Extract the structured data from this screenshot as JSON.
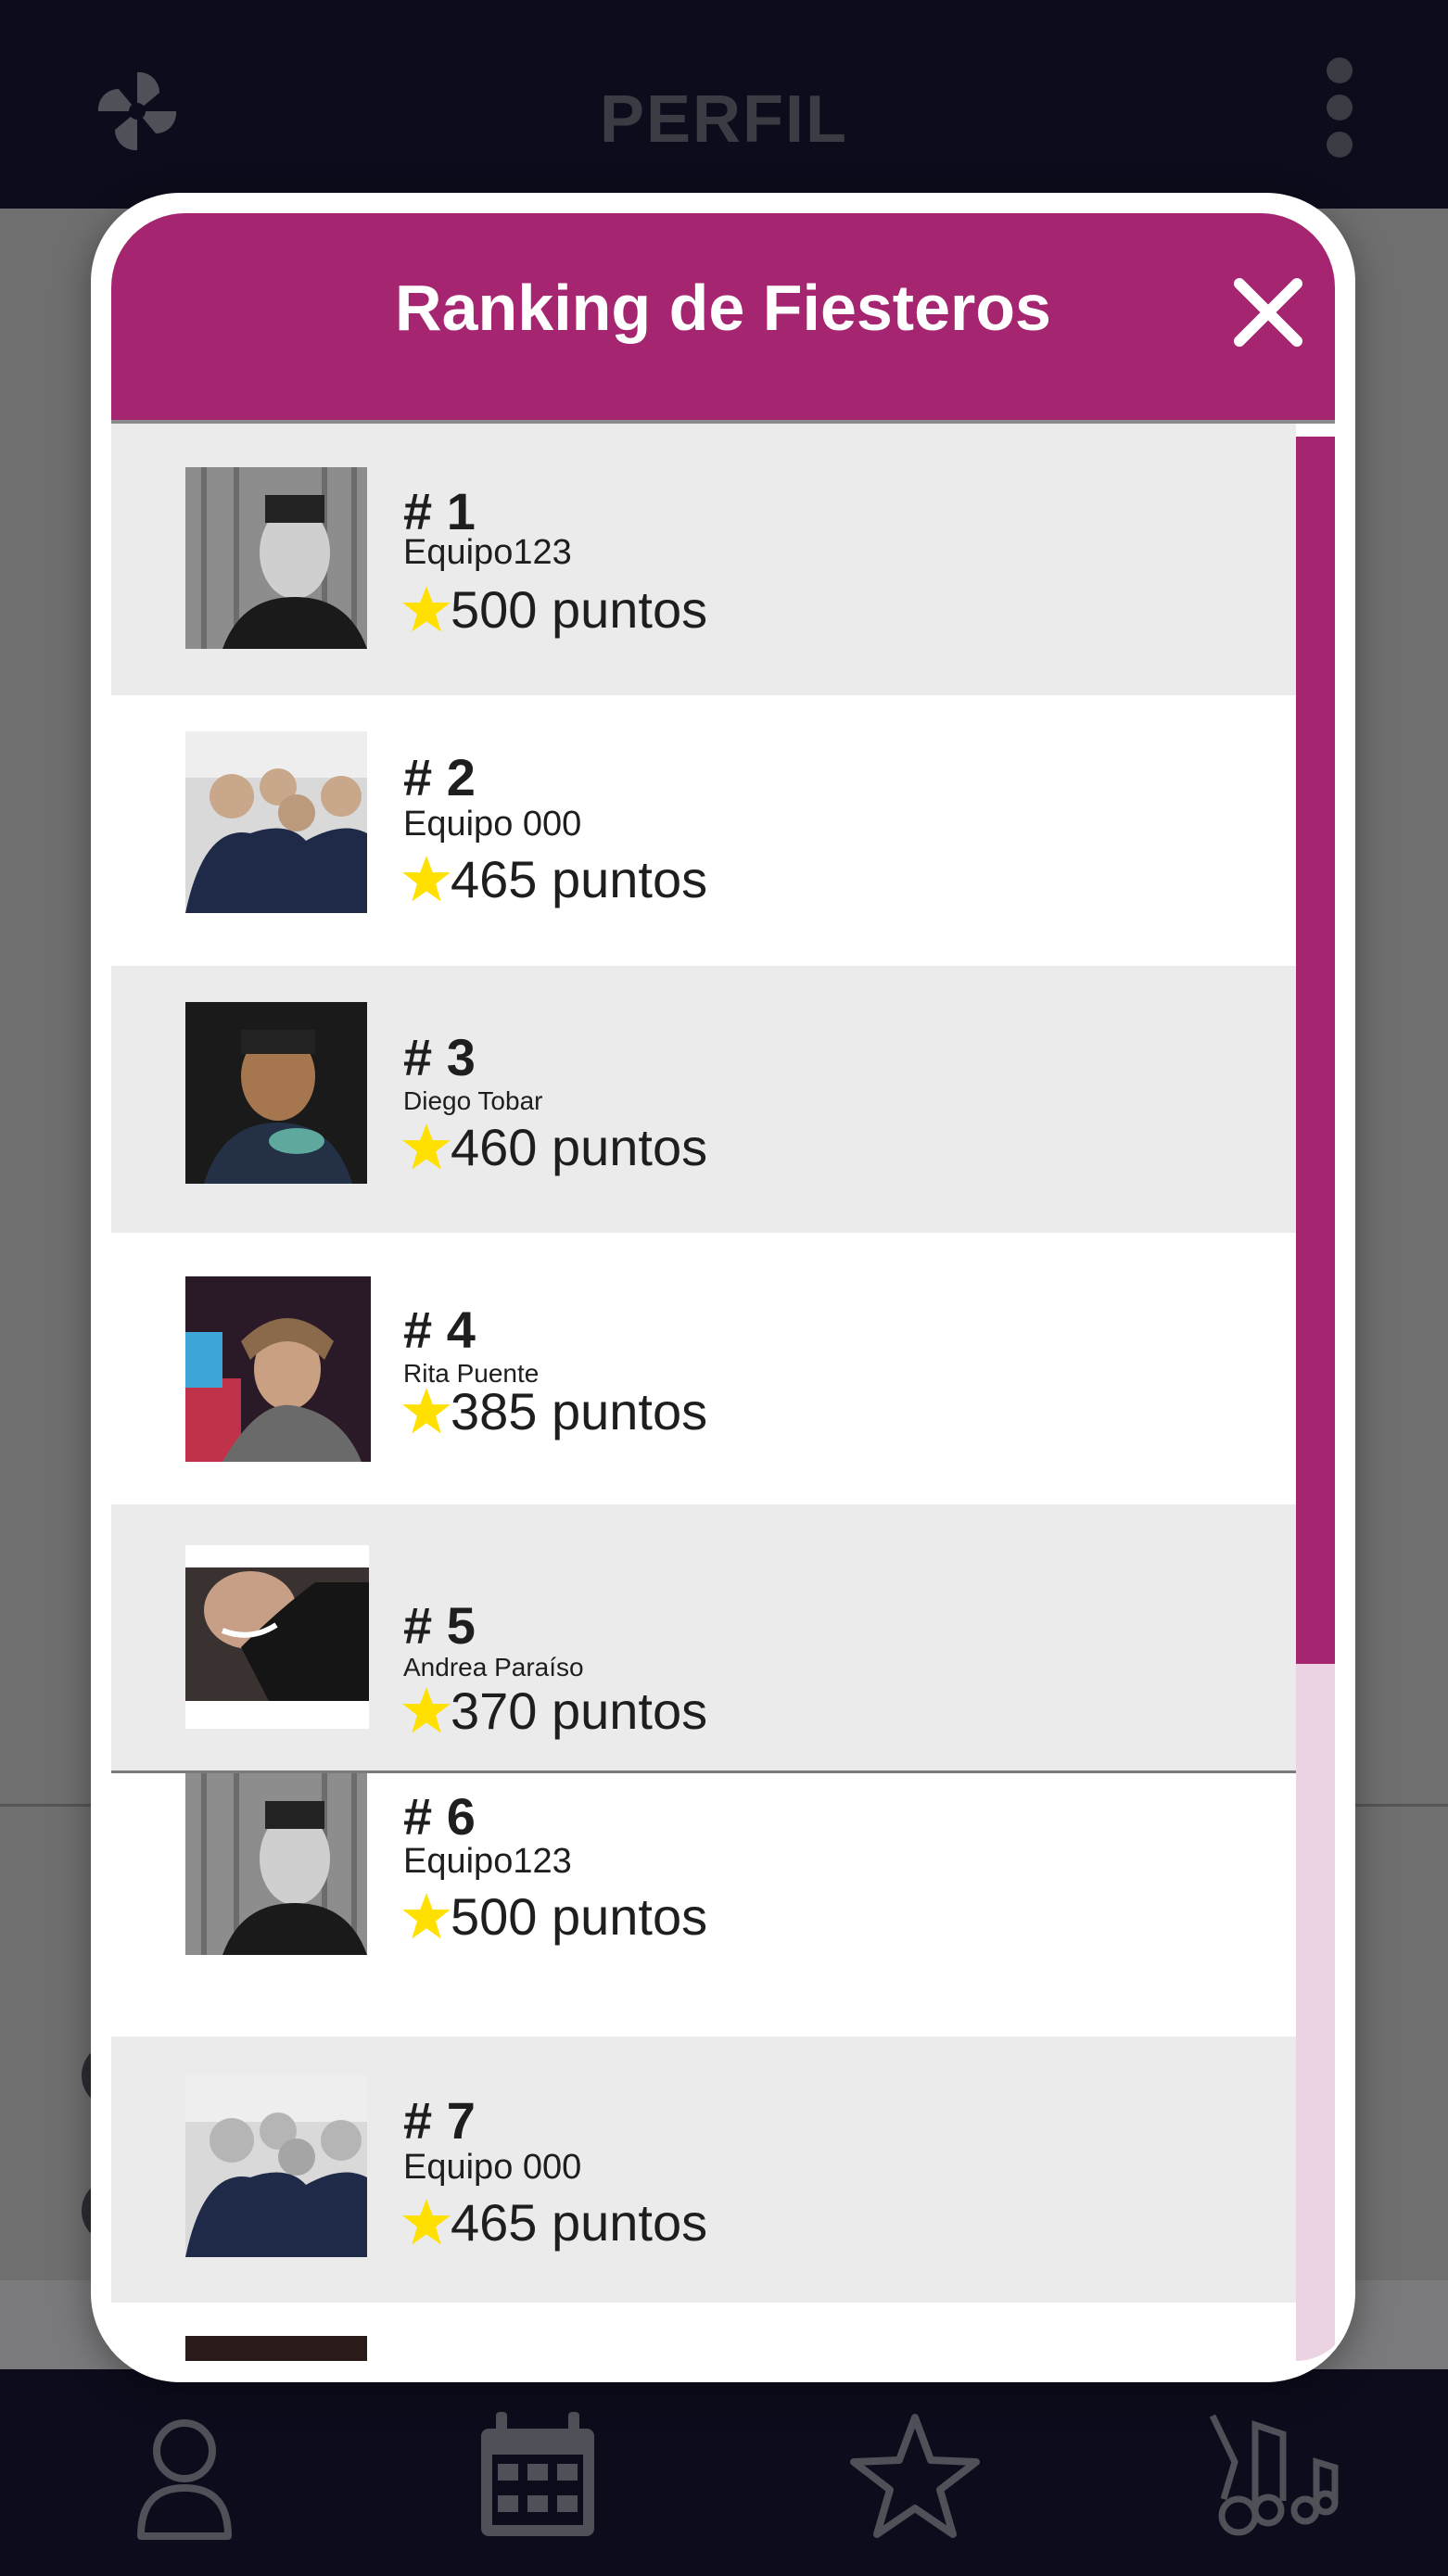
{
  "app": {
    "page_title": "PERFIL"
  },
  "modal": {
    "title": "Ranking de Fiesteros",
    "entries": [
      {
        "rank": "# 1",
        "name": "Equipo123",
        "points": "500 puntos"
      },
      {
        "rank": "# 2",
        "name": "Equipo 000",
        "points": "465 puntos"
      },
      {
        "rank": "# 3",
        "name": "Diego Tobar",
        "points": "460 puntos"
      },
      {
        "rank": "# 4",
        "name": "Rita Puente",
        "points": "385 puntos"
      },
      {
        "rank": "# 5",
        "name": "Andrea Paraíso",
        "points": "370 puntos"
      },
      {
        "rank": "# 6",
        "name": "Equipo123",
        "points": "500 puntos"
      },
      {
        "rank": "# 7",
        "name": "Equipo 000",
        "points": "465 puntos"
      }
    ]
  },
  "icons": {
    "app_logo": "pinwheel-logo-icon",
    "menu": "kebab-menu-icon",
    "close": "close-icon",
    "star": "star-icon",
    "nav": [
      "profile-icon",
      "calendar-icon",
      "star-icon",
      "music-notes-icon"
    ]
  },
  "colors": {
    "accent": "#a62570",
    "scroll_track": "#ecd3e3",
    "bar_bg": "#0c0c1c",
    "nav_icon": "#505058",
    "star": "#ffe000",
    "row_alt": "#ebebec"
  },
  "scroll_position_fraction": 0.64
}
